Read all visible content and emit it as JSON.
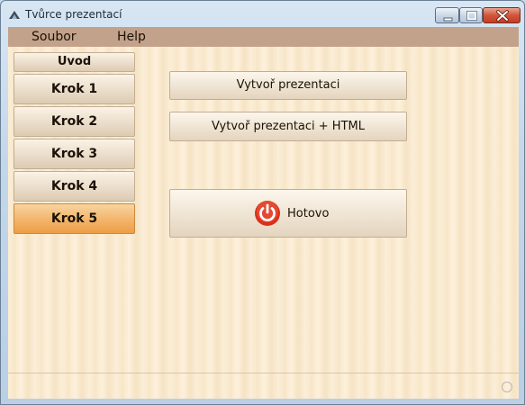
{
  "window": {
    "title": "Tvůrce prezentací"
  },
  "menu": {
    "items": [
      {
        "label": "Soubor"
      },
      {
        "label": "Help"
      }
    ]
  },
  "sidebar": {
    "items": [
      {
        "label": "Uvod",
        "active": false
      },
      {
        "label": "Krok 1",
        "active": false
      },
      {
        "label": "Krok 2",
        "active": false
      },
      {
        "label": "Krok 3",
        "active": false
      },
      {
        "label": "Krok 4",
        "active": false
      },
      {
        "label": "Krok 5",
        "active": true
      }
    ]
  },
  "main": {
    "create_button": "Vytvoř prezentaci",
    "create_html_button": "Vytvoř prezentaci + HTML",
    "done_button": "Hotovo",
    "done_icon": "power-icon"
  },
  "colors": {
    "menubar": "#c3a28b",
    "active_step": "#f3b46a",
    "power_icon": "#d8301c"
  }
}
